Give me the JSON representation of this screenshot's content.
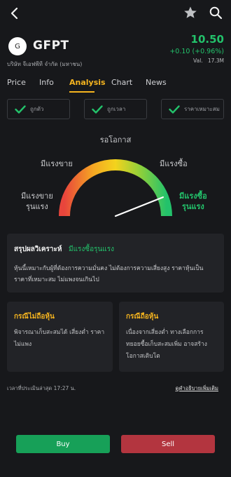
{
  "header": {
    "back_icon": "chevron-left-icon",
    "star_icon": "star-icon",
    "search_icon": "search-icon"
  },
  "stock": {
    "logo_letter": "G",
    "ticker": "GFPT",
    "company": "บริษัท จีเอฟพีที จำกัด (มหาชน)",
    "price": "10.50",
    "change": "+0.10   (+0.96%)",
    "volume_label": "Val.",
    "volume_value": "17.3M",
    "color_up": "#23c26b"
  },
  "tabs": [
    {
      "label": "Price"
    },
    {
      "label": "Info"
    },
    {
      "label": "Analysis",
      "active": true
    },
    {
      "label": "Chart"
    },
    {
      "label": "News"
    }
  ],
  "chips": [
    {
      "label": "ถูกตัว",
      "checked": true
    },
    {
      "label": "ถูกเวลา",
      "checked": true
    },
    {
      "label": "ราคาเหมาะสม",
      "checked": true
    }
  ],
  "gauge": {
    "title": "รอโอกาส",
    "labels": {
      "strong_sell_1": "มีแรงขาย",
      "strong_sell_2": "รุนแรง",
      "sell": "มีแรงขาย",
      "buy": "มีแรงซื้อ",
      "strong_buy_1": "มีแรงซื้อ",
      "strong_buy_2": "รุนแรง"
    },
    "level": 0.88,
    "colors": [
      "#e8453c",
      "#f5a623",
      "#f3d31d",
      "#8ccf3c",
      "#23c26b"
    ]
  },
  "summary": {
    "title": "สรุปผลวิเคราะห์",
    "signal": "มีแรงซื้อรุนแรง",
    "text": "หุ้นนี้เหมาะกับผู้ที่ต้องการความมั่นคง ไม่ต้องการความเสี่ยงสูง ราคาหุ้นเป็นราคาที่เหมาะสม ไม่แพงจนเกินไป"
  },
  "cases": {
    "not_holding": {
      "title": "กรณีไม่ถือหุ้น",
      "text": "พิจารณาเก็บสะสมได้ เสี่ยงต่ำ ราคาไม่แพง"
    },
    "holding": {
      "title": "กรณีถือหุ้น",
      "text": "เนื่องจากเสี่ยงต่ำ ทางเลือกการทยอยซื้อเก็บสะสมเพิ่ม อาจสร้างโอกาสเติบโต"
    }
  },
  "footer": {
    "eval_time": "เวลาที่ประเมินล่าสุด 17:27 น.",
    "more_link": "ดูคำอธิบายเพิ่มเติม"
  },
  "actions": {
    "buy": "Buy",
    "sell": "Sell"
  }
}
